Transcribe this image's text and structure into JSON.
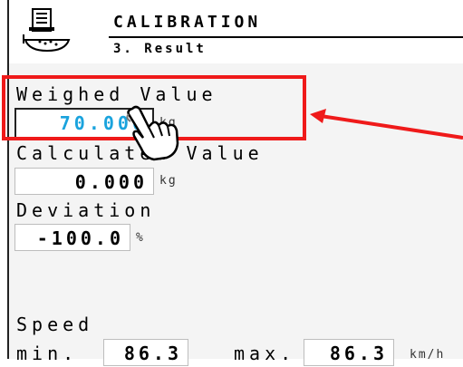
{
  "header": {
    "title": "CALIBRATION",
    "subtitle": "3. Result"
  },
  "weighed": {
    "label": "Weighed Value",
    "value": "70.000",
    "unit": "kg",
    "value_color": "#1aa3dd"
  },
  "calculated": {
    "label": "Calculated Value",
    "value": "0.000",
    "unit": "kg"
  },
  "deviation": {
    "label": "Deviation",
    "value": "-100.0",
    "unit": "%"
  },
  "speed": {
    "label": "Speed",
    "min_label": "min.",
    "min_value": "86.3",
    "max_label": "max.",
    "max_value": "86.3",
    "unit": "km/h"
  },
  "annotation": {
    "highlight_color": "#ef1a1a"
  }
}
